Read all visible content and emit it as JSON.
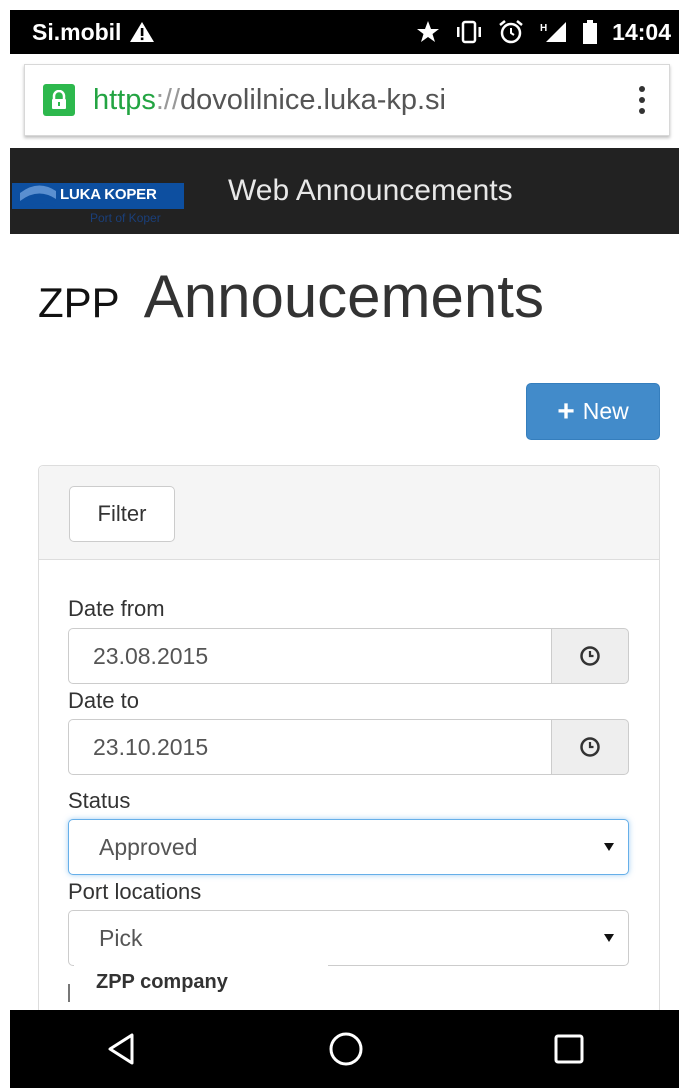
{
  "status_bar": {
    "carrier": "Si.mobil",
    "time": "14:04",
    "icons": [
      "warning-icon",
      "star-icon",
      "vibrate-icon",
      "alarm-icon",
      "signal-icon",
      "battery-icon"
    ]
  },
  "browser": {
    "url_scheme": "https",
    "url_separator": "://",
    "url_host": "dovolilnice.luka-kp.si"
  },
  "navbar": {
    "logo_text": "LUKA KOPER",
    "logo_subtext": "Port of Koper",
    "brand": "Web Announcements"
  },
  "page": {
    "title_prefix": "ZPP",
    "title": "Annoucements",
    "new_button_label": "New"
  },
  "filter": {
    "toggle_label": "Filter",
    "date_from_label": "Date from",
    "date_from_value": "23.08.2015",
    "date_to_label": "Date to",
    "date_to_value": "23.10.2015",
    "status_label": "Status",
    "status_value": "Approved",
    "port_locations_label": "Port locations",
    "port_locations_value": "Pick",
    "dropdown_option": "ZPP company"
  },
  "colors": {
    "primary": "#428bca",
    "navbar": "#222222",
    "secure": "#2db84d",
    "focus": "#66afe9"
  }
}
